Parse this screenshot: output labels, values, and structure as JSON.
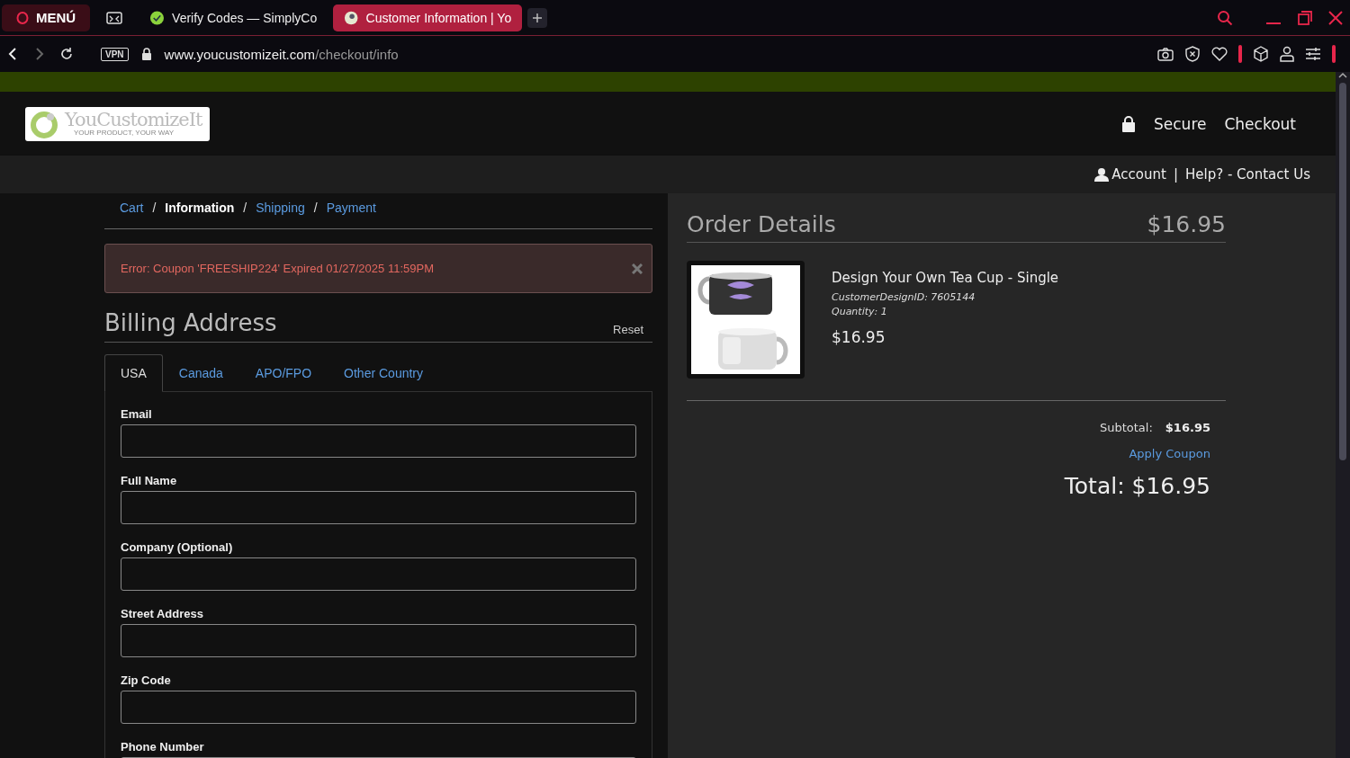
{
  "browser": {
    "menu_label": "MENÚ",
    "tabs": [
      {
        "kind": "gallery",
        "selected": false
      },
      {
        "kind": "page",
        "label": "Verify Codes — SimplyCo",
        "selected": false
      },
      {
        "kind": "page",
        "label": "Customer Information | Yo",
        "selected": true
      }
    ],
    "vpn_badge": "VPN",
    "url": {
      "host": "www.youcustomizeit.com",
      "path": "/checkout/info"
    }
  },
  "header": {
    "logo": {
      "name": "YouCustomizeIt",
      "tagline": "YOUR PRODUCT, YOUR WAY"
    },
    "secure_label": "Secure",
    "checkout_label": "Checkout"
  },
  "subnav": {
    "account": "Account",
    "separator": "|",
    "help": "Help? - Contact Us"
  },
  "breadcrumb": {
    "items": [
      {
        "label": "Cart",
        "selected": false
      },
      {
        "label": "Information",
        "selected": true
      },
      {
        "label": "Shipping",
        "selected": false
      },
      {
        "label": "Payment",
        "selected": false
      }
    ],
    "separators": [
      "/",
      "/",
      "/"
    ]
  },
  "alert": {
    "text": "Error: Coupon 'FREESHIP224' Expired 01/27/2025 11:59PM"
  },
  "billing": {
    "title": "Billing Address",
    "reset": "Reset",
    "tabs": [
      {
        "label": "USA",
        "selected": true
      },
      {
        "label": "Canada",
        "selected": false
      },
      {
        "label": "APO/FPO",
        "selected": false
      },
      {
        "label": "Other Country",
        "selected": false
      }
    ],
    "fields": [
      {
        "label": "Email"
      },
      {
        "label": "Full Name"
      },
      {
        "label": "Company (Optional)"
      },
      {
        "label": "Street Address"
      },
      {
        "label": "Zip Code"
      },
      {
        "label": "Phone Number"
      }
    ]
  },
  "order": {
    "title": "Order Details",
    "header_total": "$16.95",
    "item": {
      "kind": "picture",
      "name": "Design Your Own Tea Cup - Single",
      "design_id": "CustomerDesignID: 7605144",
      "quantity": "Quantity: 1",
      "price": "$16.95"
    },
    "subtotal_label": "Subtotal:",
    "subtotal_value": "$16.95",
    "apply_coupon": "Apply Coupon",
    "total": "Total: $16.95"
  }
}
